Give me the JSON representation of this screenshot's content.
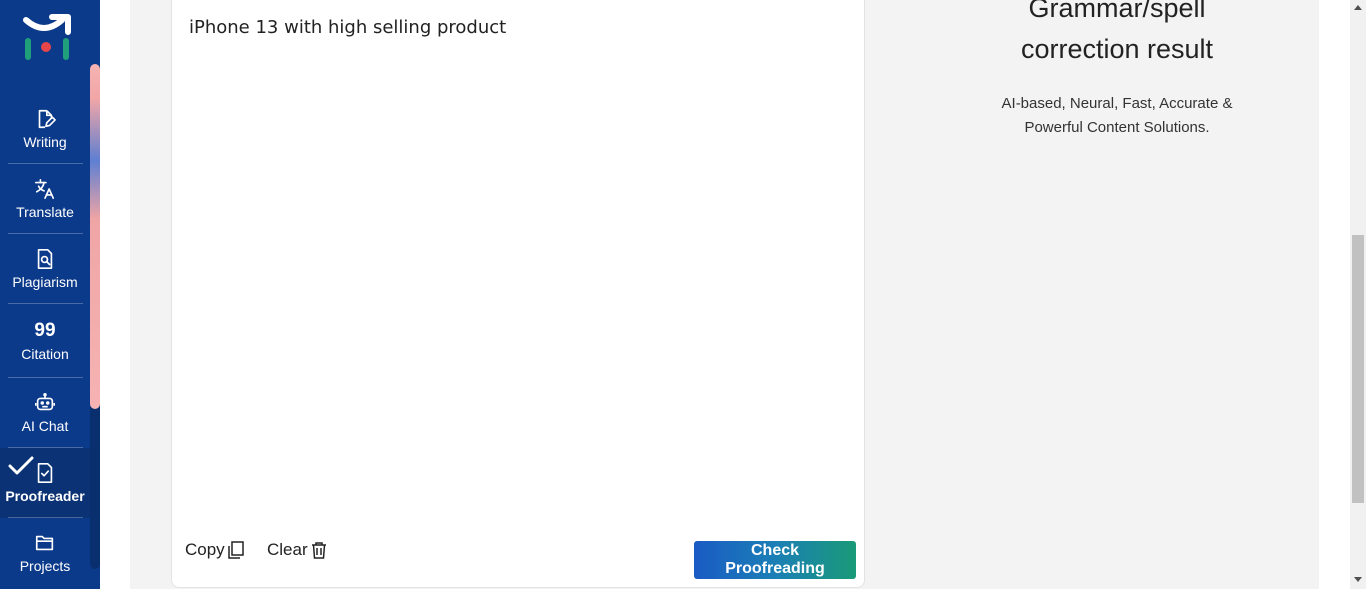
{
  "sidebar": {
    "items": [
      {
        "label": "Writing",
        "icon": "document-edit-icon"
      },
      {
        "label": "Translate",
        "icon": "translate-icon"
      },
      {
        "label": "Plagiarism",
        "icon": "document-search-icon"
      },
      {
        "label": "Citation",
        "icon": "quote-icon",
        "glyph": "99"
      },
      {
        "label": "AI Chat",
        "icon": "robot-icon"
      },
      {
        "label": "Proofreader",
        "icon": "document-check-icon",
        "active": true
      },
      {
        "label": "Projects",
        "icon": "folder-icon"
      }
    ]
  },
  "editor": {
    "text": "iPhone 13 with high selling product",
    "copy_label": "Copy",
    "clear_label": "Clear",
    "check_label": "Check Proofreading"
  },
  "result": {
    "title_line1": "Grammar/spell",
    "title_line2": "correction result",
    "subtitle_line1": "AI-based, Neural, Fast, Accurate &",
    "subtitle_line2": "Powerful Content Solutions."
  },
  "colors": {
    "sidebar_bg": "#0c3a8a",
    "panel_bg": "#f3f3f3",
    "button_gradient_start": "#1a5bc4",
    "button_gradient_end": "#1a9a77"
  }
}
